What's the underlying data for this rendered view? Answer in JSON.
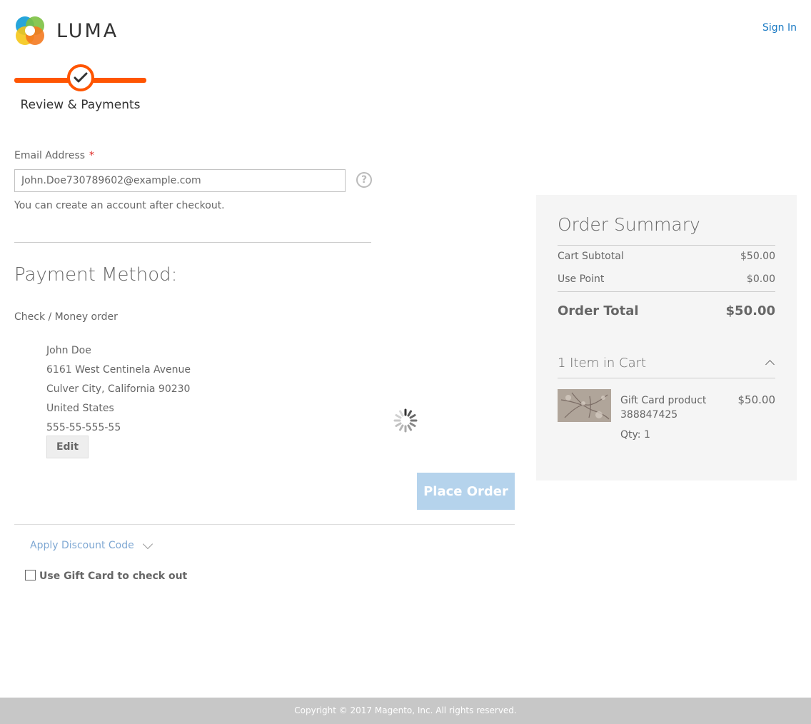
{
  "header": {
    "logo_text": "LUMA",
    "sign_in": "Sign In"
  },
  "progress": {
    "step_label": "Review & Payments"
  },
  "email": {
    "label": "Email Address",
    "required_mark": "*",
    "value": "John.Doe730789602@example.com",
    "help_icon": "?",
    "note": "You can create an account after checkout."
  },
  "payment": {
    "title": "Payment Method:",
    "option": "Check / Money order",
    "address": {
      "name": "John Doe",
      "street": "6161 West Centinela Avenue",
      "city_line": "Culver City, California 90230",
      "country": "United States",
      "phone": "555-55-555-55"
    },
    "edit_label": "Edit",
    "place_order_label": "Place Order",
    "discount_label": "Apply Discount Code",
    "gift_card_label": "Use Gift Card to check out"
  },
  "summary": {
    "title": "Order Summary",
    "rows": [
      {
        "label": "Cart Subtotal",
        "value": "$50.00"
      },
      {
        "label": "Use Point",
        "value": "$0.00"
      }
    ],
    "total_label": "Order Total",
    "total_value": "$50.00",
    "items_heading": "1 Item in Cart",
    "item": {
      "name": "Gift Card product 388847425",
      "price": "$50.00",
      "qty": "Qty: 1"
    }
  },
  "footer": {
    "copyright": "Copyright © 2017 Magento, Inc. All rights reserved."
  },
  "colors": {
    "accent": "#ff5501",
    "link": "#1979c3",
    "place_order_disabled": "#b5d3ec"
  },
  "icons": [
    "luma-logo-icon",
    "checkmark-icon",
    "help-icon",
    "loading-spinner-icon",
    "chevron-down-icon",
    "chevron-up-icon",
    "checkbox-icon"
  ]
}
